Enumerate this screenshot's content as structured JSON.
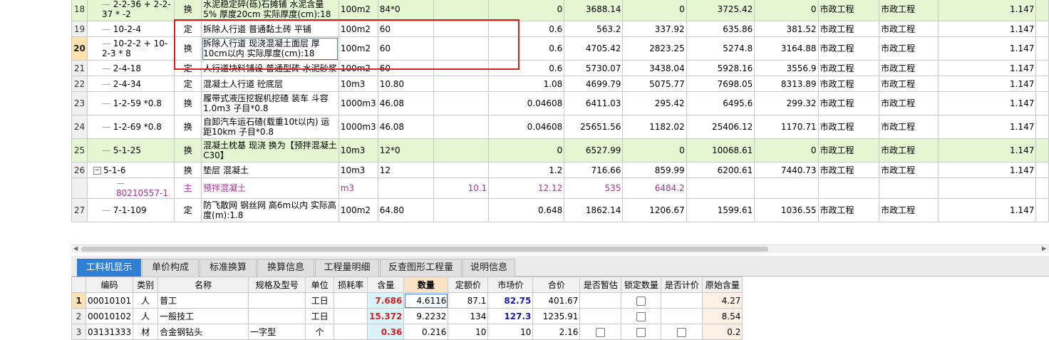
{
  "upper": {
    "rows": [
      {
        "no": "18",
        "code": "2-2-36 + 2-2-37 * -2",
        "type": "换",
        "name": "水泥稳定碎(砾)石摊铺 水泥含量5% 厚度20cm  实际厚度(cm):18",
        "unit": "100m2",
        "qty": "84*0",
        "c1": "",
        "c2": "0",
        "c3": "3688.14",
        "c4": "0",
        "c5": "3725.42",
        "c6": "0",
        "cat1": "市政工程",
        "cat2": "市政工程",
        "coef": "1.147",
        "style": "green"
      },
      {
        "no": "19",
        "code": "10-2-4",
        "type": "定",
        "name": "拆除人行道 普通黏土砖 平铺",
        "unit": "100m2",
        "qty": "60",
        "c1": "",
        "c2": "0.6",
        "c3": "563.2",
        "c4": "337.92",
        "c5": "635.86",
        "c6": "381.52",
        "cat1": "市政工程",
        "cat2": "市政工程",
        "coef": "1.147",
        "style": ""
      },
      {
        "no": "20",
        "code": "10-2-2 + 10-2-3 * 8",
        "type": "换",
        "name": "拆除人行道 现浇混凝土面层 厚10cm以内  实际厚度(cm):18",
        "unit": "100m2",
        "qty": "60",
        "c1": "",
        "c2": "0.6",
        "c3": "4705.42",
        "c4": "2823.25",
        "c5": "5274.8",
        "c6": "3164.88",
        "cat1": "市政工程",
        "cat2": "市政工程",
        "coef": "1.147",
        "style": "sel"
      },
      {
        "no": "21",
        "code": "2-4-18",
        "type": "定",
        "name": "人行道块料铺设 普通型砖 水泥砂浆",
        "unit": "100m2",
        "qty": "60",
        "c1": "",
        "c2": "0.6",
        "c3": "5730.07",
        "c4": "3438.04",
        "c5": "5928.16",
        "c6": "3556.9",
        "cat1": "市政工程",
        "cat2": "市政工程",
        "coef": "1.147",
        "style": ""
      },
      {
        "no": "22",
        "code": "2-4-34",
        "type": "定",
        "name": "混凝土人行道 砼底层",
        "unit": "10m3",
        "qty": "10.80",
        "c1": "",
        "c2": "1.08",
        "c3": "4699.79",
        "c4": "5075.77",
        "c5": "7698.05",
        "c6": "8313.89",
        "cat1": "市政工程",
        "cat2": "市政工程",
        "coef": "1.147",
        "style": ""
      },
      {
        "no": "23",
        "code": "1-2-59 *0.8",
        "type": "换",
        "name": "履带式液压挖掘机挖碴 装车 斗容1.0m3  子目*0.8",
        "unit": "1000m3",
        "qty": "46.08",
        "c1": "",
        "c2": "0.04608",
        "c3": "6411.03",
        "c4": "295.42",
        "c5": "6495.6",
        "c6": "299.32",
        "cat1": "市政工程",
        "cat2": "市政工程",
        "coef": "1.147",
        "style": ""
      },
      {
        "no": "24",
        "code": "1-2-69 *0.8",
        "type": "换",
        "name": "自卸汽车运石碴(载重10t以内) 运距10km  子目*0.8",
        "unit": "1000m3",
        "qty": "46.08",
        "c1": "",
        "c2": "0.04608",
        "c3": "25651.56",
        "c4": "1182.02",
        "c5": "25406.12",
        "c6": "1170.71",
        "cat1": "市政工程",
        "cat2": "市政工程",
        "coef": "1.147",
        "style": ""
      },
      {
        "no": "25",
        "code": "5-1-25",
        "type": "换",
        "name": "混凝土枕基 现浇  换为【预拌混凝土C30】",
        "unit": "10m3",
        "qty": "12*0",
        "c1": "",
        "c2": "0",
        "c3": "6527.99",
        "c4": "0",
        "c5": "10068.61",
        "c6": "0",
        "cat1": "市政工程",
        "cat2": "市政工程",
        "coef": "1.147",
        "style": "green"
      },
      {
        "no": "26",
        "code": "5-1-6",
        "type": "换",
        "name": "垫层 混凝土",
        "unit": "10m3",
        "qty": "12",
        "c1": "",
        "c2": "1.2",
        "c3": "716.66",
        "c4": "859.99",
        "c5": "6200.61",
        "c6": "7440.73",
        "cat1": "市政工程",
        "cat2": "市政工程",
        "coef": "1.147",
        "style": "tree"
      },
      {
        "no": "",
        "code": "80210557-1",
        "type": "主",
        "name": "预拌混凝土",
        "unit": "m3",
        "qty": "",
        "c1": "10.1",
        "c2": "12.12",
        "c3": "535",
        "c4": "6484.2",
        "c5": "",
        "c6": "",
        "cat1": "",
        "cat2": "",
        "coef": "",
        "style": "sub"
      },
      {
        "no": "27",
        "code": "7-1-109",
        "type": "定",
        "name": "防飞散网 钢丝网 高6m以内  实际高度(m):1.8",
        "unit": "100m2",
        "qty": "64.80",
        "c1": "",
        "c2": "0.648",
        "c3": "1862.14",
        "c4": "1206.67",
        "c5": "1599.61",
        "c6": "1036.55",
        "cat1": "市政工程",
        "cat2": "市政工程",
        "coef": "1.147",
        "style": ""
      }
    ]
  },
  "tabs": [
    "工料机显示",
    "单价构成",
    "标准换算",
    "换算信息",
    "工程量明细",
    "反查图形工程量",
    "说明信息"
  ],
  "lower": {
    "headers": [
      "",
      "编码",
      "类别",
      "名称",
      "规格及型号",
      "单位",
      "损耗率",
      "含量",
      "数量",
      "定额价",
      "市场价",
      "合价",
      "是否暂估",
      "锁定数量",
      "是否计价",
      "原始含量"
    ],
    "rows": [
      {
        "no": "1",
        "code": "00010101",
        "cat": "人",
        "name": "普工",
        "spec": "",
        "unit": "工日",
        "loss": "",
        "content": "7.686",
        "qty": "4.6116",
        "quota": "87.1",
        "market": "82.75",
        "total": "401.67",
        "orig": "4.27"
      },
      {
        "no": "2",
        "code": "00010102",
        "cat": "人",
        "name": "一般技工",
        "spec": "",
        "unit": "工日",
        "loss": "",
        "content": "15.372",
        "qty": "9.2232",
        "quota": "134",
        "market": "127.3",
        "total": "1235.91",
        "orig": "8.54"
      },
      {
        "no": "3",
        "code": "03131333",
        "cat": "材",
        "name": "合金钢钻头",
        "spec": "一字型",
        "unit": "个",
        "loss": "",
        "content": "0.36",
        "qty": "0.216",
        "quota": "10",
        "market": "10",
        "total": "2.16",
        "orig": "0.2"
      }
    ]
  }
}
